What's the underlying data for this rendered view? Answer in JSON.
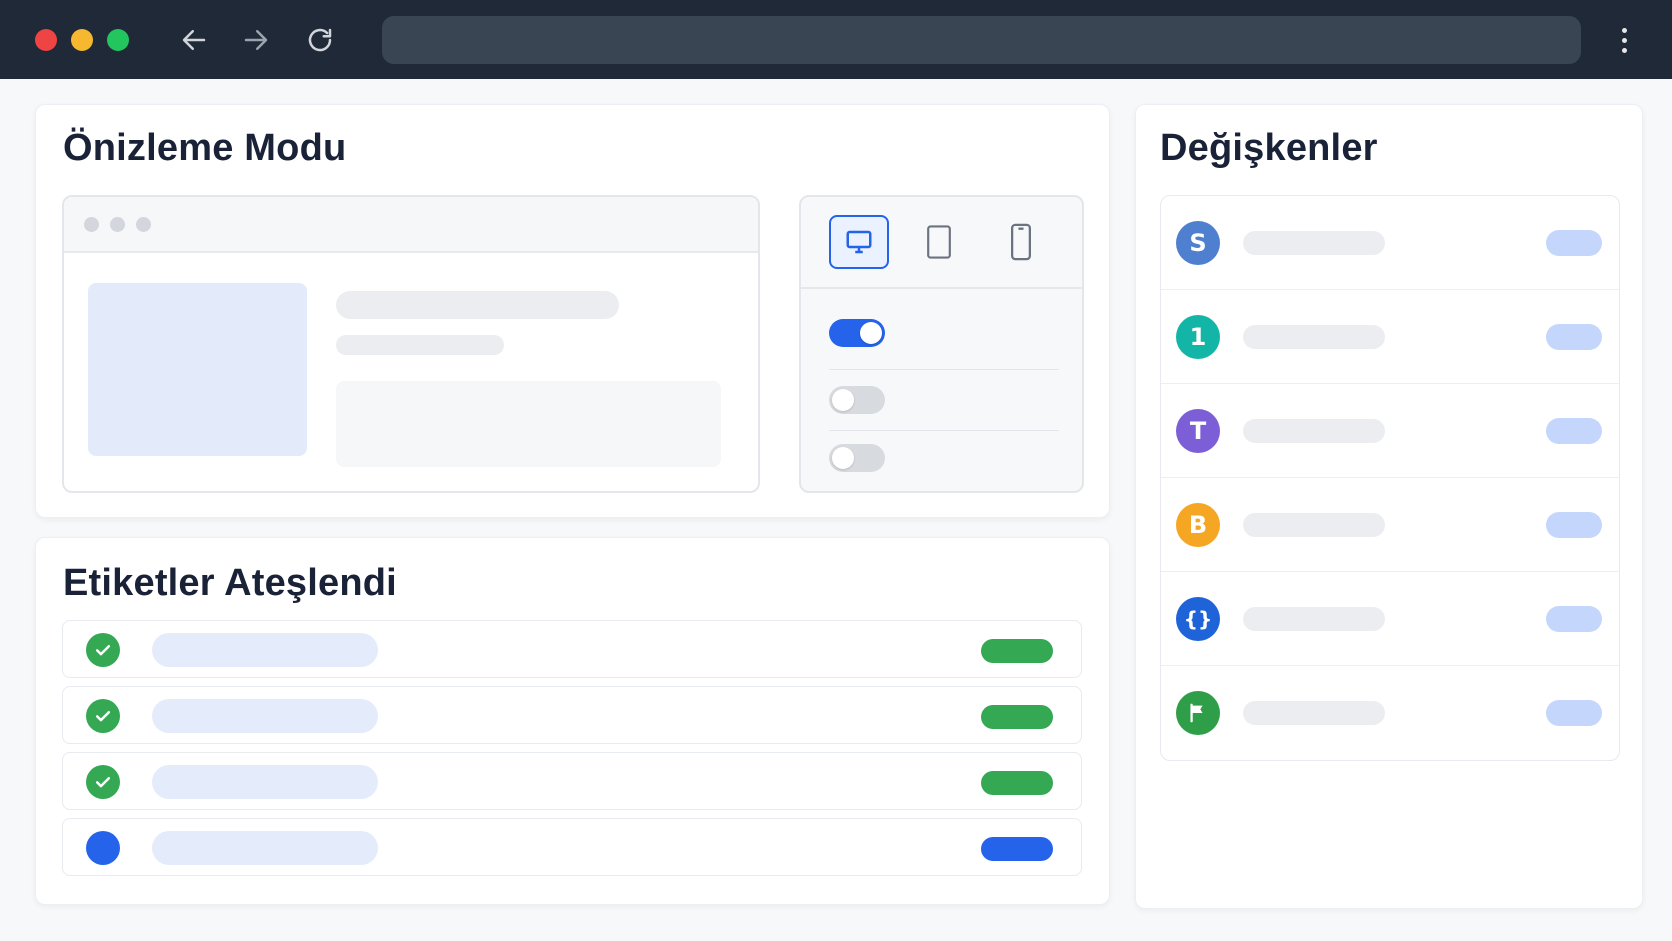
{
  "browser": {
    "url": "",
    "traffic_lights": [
      "#ef4444",
      "#f5b82e",
      "#22c55e"
    ],
    "nav_icons": [
      "arrow-left-icon",
      "arrow-right-icon",
      "reload-icon"
    ],
    "menu_icon": "more-vertical-icon"
  },
  "preview": {
    "title": "Önizleme Modu",
    "devices": [
      {
        "name": "desktop",
        "icon": "monitor-icon",
        "active": true
      },
      {
        "name": "tablet",
        "icon": "tablet-icon",
        "active": false
      },
      {
        "name": "mobile",
        "icon": "smartphone-icon",
        "active": false
      }
    ],
    "toggles": [
      true,
      false,
      false
    ]
  },
  "tags": {
    "title": "Etiketler Ateşlendi",
    "rows": [
      {
        "status": "fired",
        "icon": "check-icon",
        "color": "#34a853"
      },
      {
        "status": "fired",
        "icon": "check-icon",
        "color": "#34a853"
      },
      {
        "status": "fired",
        "icon": "check-icon",
        "color": "#34a853"
      },
      {
        "status": "pending",
        "icon": "dot-icon",
        "color": "#2563eb"
      }
    ]
  },
  "variables": {
    "title": "Değişkenler",
    "rows": [
      {
        "badge": "S",
        "color": "#4f7fcf"
      },
      {
        "badge": "1",
        "color": "#13b5a6"
      },
      {
        "badge": "T",
        "color": "#7c5fd6"
      },
      {
        "badge": "B",
        "color": "#f5a623"
      },
      {
        "badge": "{}",
        "color": "#1f63d8"
      },
      {
        "badge": "",
        "icon": "flag-icon",
        "color": "#2e9e48"
      }
    ]
  },
  "colors": {
    "accent": "#2563eb",
    "success": "#34a853",
    "chrome": "#1f2937"
  }
}
